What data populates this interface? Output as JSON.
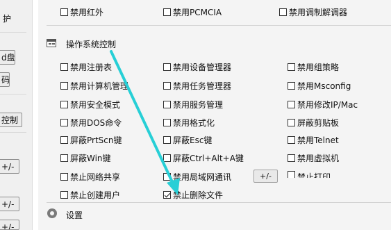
{
  "left": {
    "text1": "护",
    "btn_disk": "d盘",
    "btn_code": "码",
    "btn_ctrl": "控制",
    "btn_pm1": "+/-",
    "btn_pm2": "+/-",
    "btn_pm3": "+/-"
  },
  "top_row": [
    {
      "label": "禁用红外",
      "checked": false
    },
    {
      "label": "禁用PCMCIA",
      "checked": false
    },
    {
      "label": "禁用调制解调器",
      "checked": false
    }
  ],
  "os_section": {
    "title": "操作系统控制",
    "col1": [
      {
        "label": "禁用注册表",
        "checked": false
      },
      {
        "label": "禁用计算机管理",
        "checked": false
      },
      {
        "label": "禁用安全模式",
        "checked": false
      },
      {
        "label": "禁用DOS命令",
        "checked": false
      },
      {
        "label": "屏蔽PrtScn键",
        "checked": false
      },
      {
        "label": "屏蔽Win键",
        "checked": false
      },
      {
        "label": "禁止网络共享",
        "checked": false
      },
      {
        "label": "禁止创建用户",
        "checked": false
      }
    ],
    "col2": [
      {
        "label": "禁用设备管理器",
        "checked": false
      },
      {
        "label": "禁用任务管理器",
        "checked": false
      },
      {
        "label": "禁用服务管理",
        "checked": false
      },
      {
        "label": "禁用格式化",
        "checked": false
      },
      {
        "label": "屏蔽Esc键",
        "checked": false
      },
      {
        "label": "屏蔽Ctrl+Alt+A键",
        "checked": false
      },
      {
        "label": "禁用局域网通讯",
        "checked": false
      },
      {
        "label": "禁止删除文件",
        "checked": true
      }
    ],
    "col3": [
      {
        "label": "禁用组策略",
        "checked": false
      },
      {
        "label": "禁用Msconfig",
        "checked": false
      },
      {
        "label": "禁用修改IP/Mac",
        "checked": false
      },
      {
        "label": "屏蔽剪贴板",
        "checked": false
      },
      {
        "label": "禁用Telnet",
        "checked": false
      },
      {
        "label": "禁用虚拟机",
        "checked": false
      },
      {
        "label": "禁止打印",
        "checked": false
      }
    ],
    "lan_button": "+/-"
  },
  "settings": {
    "title": "设置"
  },
  "colors": {
    "arrow": "#27cfd6",
    "background": "#f4f4f4"
  }
}
